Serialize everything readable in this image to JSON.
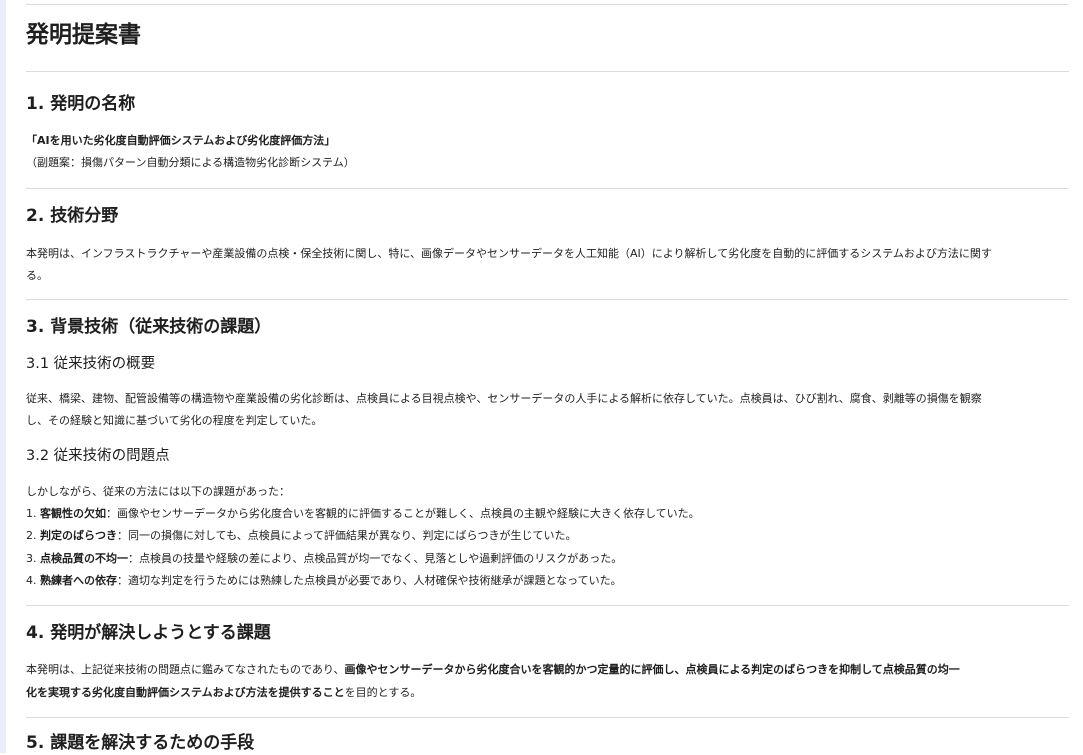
{
  "title": "発明提案書",
  "sections": [
    {
      "heading": "1. 発明の名称",
      "name_line": "「AIを用いた劣化度自動評価システムおよび劣化度評価方法」",
      "subtitle_line": "（副題案：損傷パターン自動分類による構造物劣化診断システム）"
    },
    {
      "heading": "2. 技術分野",
      "para_l1": "本発明は、インフラストラクチャーや産業設備の点検・保全技術に関し、特に、画像データやセンサーデータを人工知能（AI）により解析して劣化度を自動的に評価するシステムおよび方法に関す",
      "para_l2": "る。"
    },
    {
      "heading": "3. 背景技術（従来技術の課題）",
      "sub1": "3.1 従来技術の概要",
      "sub1_l1": "従来、橋梁、建物、配管設備等の構造物や産業設備の劣化診断は、点検員による目視点検や、センサーデータの人手による解析に依存していた。点検員は、ひび割れ、腐食、剥離等の損傷を観察",
      "sub1_l2": "し、その経験と知識に基づいて劣化の程度を判定していた。",
      "sub2": "3.2 従来技術の問題点",
      "sub2_intro": "しかしながら、従来の方法には以下の課題があった：",
      "items": [
        {
          "num": "1. ",
          "term": "客観性の欠如",
          "text": "：画像やセンサーデータから劣化度合いを客観的に評価することが難しく、点検員の主観や経験に大きく依存していた。"
        },
        {
          "num": "2. ",
          "term": "判定のばらつき",
          "text": "：同一の損傷に対しても、点検員によって評価結果が異なり、判定にばらつきが生じていた。"
        },
        {
          "num": "3. ",
          "term": "点検品質の不均一",
          "text": "：点検員の技量や経験の差により、点検品質が均一でなく、見落としや過剰評価のリスクがあった。"
        },
        {
          "num": "4. ",
          "term": "熟練者への依存",
          "text": "：適切な判定を行うためには熟練した点検員が必要であり、人材確保や技術継承が課題となっていた。"
        }
      ]
    },
    {
      "heading": "4. 発明が解決しようとする課題",
      "l1_a": "本発明は、上記従来技術の問題点に鑑みてなされたものであり、",
      "l1_b": "画像やセンサーデータから劣化度合いを客観的かつ定量的に評価し、点検員による判定のばらつきを抑制して点検品質の均一",
      "l2_a": "化を実現する劣化度自動評価システムおよび方法を提供すること",
      "l2_b": "を目的とする。"
    },
    {
      "heading": "5. 課題を解決するための手段"
    }
  ]
}
